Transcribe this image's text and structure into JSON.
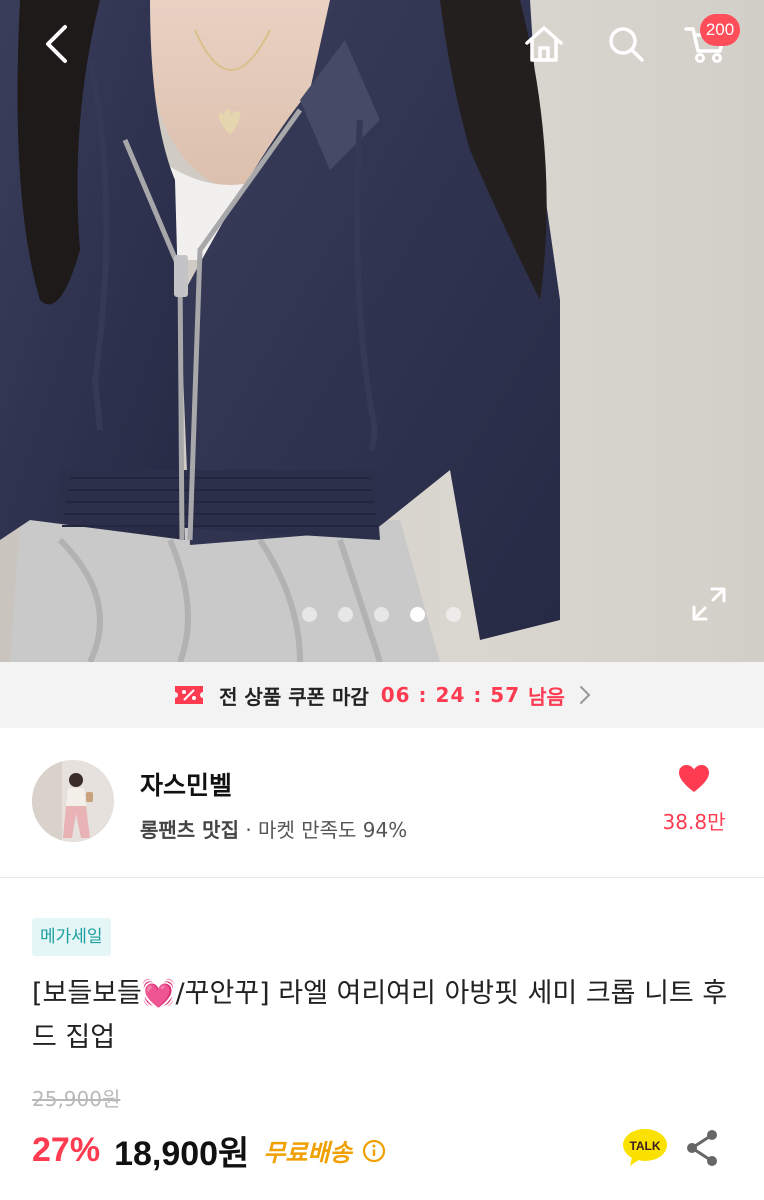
{
  "header": {
    "cart_count": "200"
  },
  "icons": {
    "back": "chevron-left-icon",
    "home": "home-icon",
    "search": "search-icon",
    "cart": "cart-icon",
    "expand": "expand-icon",
    "coupon": "coupon-icon",
    "heart": "heart-icon",
    "info": "info-icon",
    "talk": "kakaotalk-icon",
    "share": "share-icon"
  },
  "gallery": {
    "total": 5,
    "active_index": 3
  },
  "coupon_bar": {
    "label": "전 상품 쿠폰 마감",
    "timer": "06 : 24 : 57",
    "suffix": "남음"
  },
  "seller": {
    "name": "자스민벨",
    "tagline": "롱팬츠 맛집",
    "separator": " · ",
    "rating": "마켓 만족도 94%",
    "favorites": "38.8만"
  },
  "product": {
    "badge": "메가세일",
    "title": "[보들보들💓/꾸안꾸] 라엘 여리여리 아방핏 세미 크롭 니트 후드 집업",
    "original_price": "25,900원",
    "discount": "27%",
    "price": "18,900원",
    "shipping": "무료배송",
    "talk_label": "TALK"
  },
  "colors": {
    "accent_red": "#ff3b52",
    "badge_teal": "#1e9ea1",
    "shipping_yellow": "#f0a000",
    "talk_yellow": "#fae100"
  }
}
